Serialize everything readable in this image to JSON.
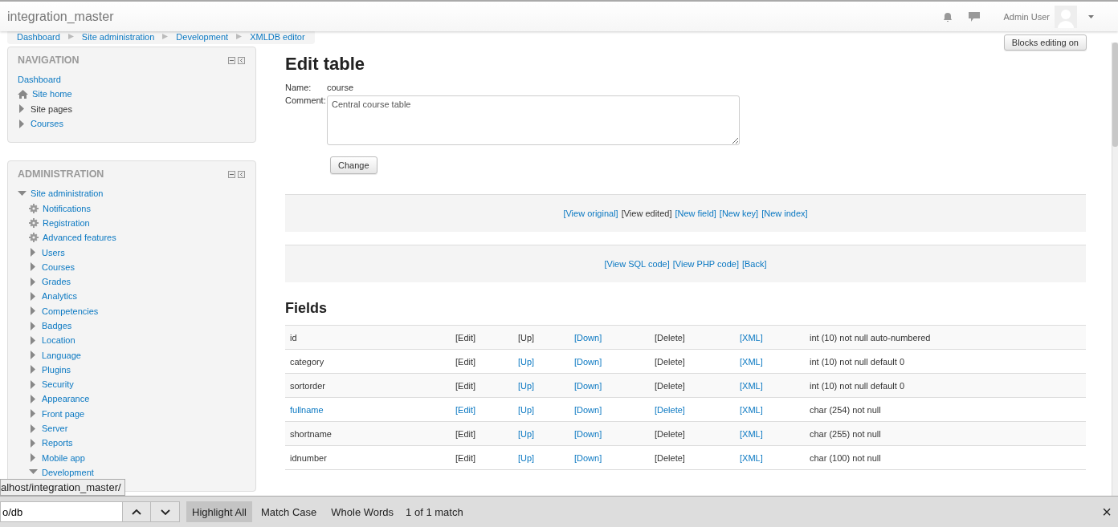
{
  "header": {
    "site_name": "integration_master",
    "user_name": "Admin User"
  },
  "breadcrumb": [
    "Dashboard",
    "Site administration",
    "Development",
    "XMLDB editor"
  ],
  "blocks_button": "Blocks editing on",
  "navigation": {
    "title": "NAVIGATION",
    "items": [
      {
        "label": "Dashboard",
        "kind": "plain",
        "link": true
      },
      {
        "label": "Site home",
        "kind": "home",
        "link": true
      },
      {
        "label": "Site pages",
        "kind": "branch",
        "link": false,
        "expanded": false
      },
      {
        "label": "Courses",
        "kind": "branch",
        "link": true,
        "expanded": false
      }
    ]
  },
  "administration": {
    "title": "ADMINISTRATION",
    "items": [
      {
        "label": "Site administration",
        "kind": "branch",
        "link": true,
        "expanded": true,
        "children": [
          {
            "label": "Notifications",
            "kind": "gear",
            "link": true
          },
          {
            "label": "Registration",
            "kind": "gear",
            "link": true
          },
          {
            "label": "Advanced features",
            "kind": "gear",
            "link": true
          },
          {
            "label": "Users",
            "kind": "branch",
            "link": true,
            "expanded": false
          },
          {
            "label": "Courses",
            "kind": "branch",
            "link": true,
            "expanded": false
          },
          {
            "label": "Grades",
            "kind": "branch",
            "link": true,
            "expanded": false
          },
          {
            "label": "Analytics",
            "kind": "branch",
            "link": true,
            "expanded": false
          },
          {
            "label": "Competencies",
            "kind": "branch",
            "link": true,
            "expanded": false
          },
          {
            "label": "Badges",
            "kind": "branch",
            "link": true,
            "expanded": false
          },
          {
            "label": "Location",
            "kind": "branch",
            "link": true,
            "expanded": false
          },
          {
            "label": "Language",
            "kind": "branch",
            "link": true,
            "expanded": false
          },
          {
            "label": "Plugins",
            "kind": "branch",
            "link": true,
            "expanded": false
          },
          {
            "label": "Security",
            "kind": "branch",
            "link": true,
            "expanded": false
          },
          {
            "label": "Appearance",
            "kind": "branch",
            "link": true,
            "expanded": false
          },
          {
            "label": "Front page",
            "kind": "branch",
            "link": true,
            "expanded": false
          },
          {
            "label": "Server",
            "kind": "branch",
            "link": true,
            "expanded": false
          },
          {
            "label": "Reports",
            "kind": "branch",
            "link": true,
            "expanded": false
          },
          {
            "label": "Mobile app",
            "kind": "branch",
            "link": true,
            "expanded": false
          },
          {
            "label": "Development",
            "kind": "branch",
            "link": true,
            "expanded": true
          }
        ]
      }
    ]
  },
  "edit": {
    "title": "Edit table",
    "name_label": "Name:",
    "name_value": "course",
    "comment_label": "Comment:",
    "comment_value": "Central course table",
    "change_button": "Change"
  },
  "action_bars": [
    [
      {
        "text": "[View original]",
        "link": true
      },
      {
        "text": "[View edited]",
        "link": false
      },
      {
        "text": "[New field]",
        "link": true
      },
      {
        "text": "[New key]",
        "link": true
      },
      {
        "text": "[New index]",
        "link": true
      }
    ],
    [
      {
        "text": "[View SQL code]",
        "link": true
      },
      {
        "text": "[View PHP code]",
        "link": true
      },
      {
        "text": "[Back]",
        "link": true
      }
    ]
  ],
  "fields": {
    "title": "Fields",
    "rows": [
      {
        "name": {
          "text": "id",
          "link": false
        },
        "actions": [
          {
            "text": "[Edit]",
            "link": false
          },
          {
            "text": "[Up]",
            "link": false
          },
          {
            "text": "[Down]",
            "link": true
          },
          {
            "text": "[Delete]",
            "link": false
          },
          {
            "text": "[XML]",
            "link": true
          }
        ],
        "type": "int (10) not null auto-numbered"
      },
      {
        "name": {
          "text": "category",
          "link": false
        },
        "actions": [
          {
            "text": "[Edit]",
            "link": false
          },
          {
            "text": "[Up]",
            "link": true
          },
          {
            "text": "[Down]",
            "link": true
          },
          {
            "text": "[Delete]",
            "link": false
          },
          {
            "text": "[XML]",
            "link": true
          }
        ],
        "type": "int (10) not null default 0"
      },
      {
        "name": {
          "text": "sortorder",
          "link": false
        },
        "actions": [
          {
            "text": "[Edit]",
            "link": false
          },
          {
            "text": "[Up]",
            "link": true
          },
          {
            "text": "[Down]",
            "link": true
          },
          {
            "text": "[Delete]",
            "link": false
          },
          {
            "text": "[XML]",
            "link": true
          }
        ],
        "type": "int (10) not null default 0"
      },
      {
        "name": {
          "text": "fullname",
          "link": true
        },
        "actions": [
          {
            "text": "[Edit]",
            "link": true
          },
          {
            "text": "[Up]",
            "link": true
          },
          {
            "text": "[Down]",
            "link": true
          },
          {
            "text": "[Delete]",
            "link": true
          },
          {
            "text": "[XML]",
            "link": true
          }
        ],
        "type": "char (254) not null"
      },
      {
        "name": {
          "text": "shortname",
          "link": false
        },
        "actions": [
          {
            "text": "[Edit]",
            "link": false
          },
          {
            "text": "[Up]",
            "link": true
          },
          {
            "text": "[Down]",
            "link": true
          },
          {
            "text": "[Delete]",
            "link": false
          },
          {
            "text": "[XML]",
            "link": true
          }
        ],
        "type": "char (255) not null"
      },
      {
        "name": {
          "text": "idnumber",
          "link": false
        },
        "actions": [
          {
            "text": "[Edit]",
            "link": false
          },
          {
            "text": "[Up]",
            "link": true
          },
          {
            "text": "[Down]",
            "link": true
          },
          {
            "text": "[Delete]",
            "link": false
          },
          {
            "text": "[XML]",
            "link": true
          }
        ],
        "type": "char (100) not null"
      }
    ]
  },
  "status_url": "alhost/integration_master/",
  "find_bar": {
    "value": "o/db",
    "toggles": [
      {
        "label": "Highlight All",
        "selected": true
      },
      {
        "label": "Match Case",
        "selected": false
      },
      {
        "label": "Whole Words",
        "selected": false
      }
    ],
    "result": "1 of 1 match",
    "close": "×"
  }
}
